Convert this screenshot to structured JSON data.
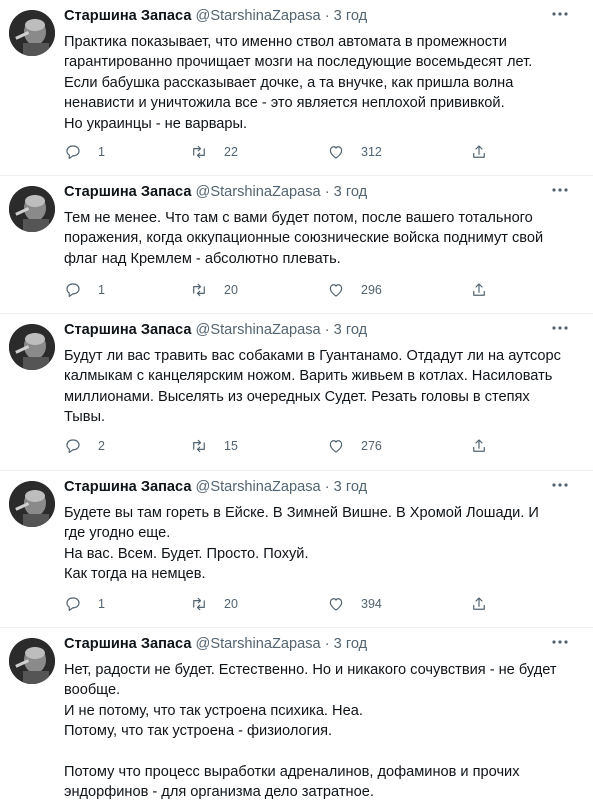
{
  "tweets": [
    {
      "name": "Старшина Запаса",
      "handle": "@StarshinaZapasa",
      "dot": "·",
      "time": "3 год",
      "text": "Практика показывает, что именно ствол автомата в промежности\nгарантированно прочищает мозги на последующие восемьдесят лет.\nЕсли бабушка рассказывает дочке, а та внучке, как пришла волна\nненависти и уничтожила все - это является неплохой прививкой.\nНо украинцы - не варвары.",
      "replies": "1",
      "retweets": "22",
      "likes": "312"
    },
    {
      "name": "Старшина Запаса",
      "handle": "@StarshinaZapasa",
      "dot": "·",
      "time": "3 год",
      "text": "Тем не менее. Что там с вами будет потом, после вашего тотального\nпоражения, когда оккупационные союзнические войска поднимут свой\nфлаг над Кремлем - абсолютно плевать.",
      "replies": "1",
      "retweets": "20",
      "likes": "296"
    },
    {
      "name": "Старшина Запаса",
      "handle": "@StarshinaZapasa",
      "dot": "·",
      "time": "3 год",
      "text": "Будут ли вас травить вас собаками в Гуантанамо. Отдадут ли на аутсорс\nкалмыкам с канцелярским ножом. Варить живьем в котлах. Насиловать\nмиллионами. Выселять из очередных Судет. Резать головы в степях\nТывы.",
      "replies": "2",
      "retweets": "15",
      "likes": "276"
    },
    {
      "name": "Старшина Запаса",
      "handle": "@StarshinaZapasa",
      "dot": "·",
      "time": "3 год",
      "text": "Будете вы там гореть в Ейске. В Зимней Вишне. В Хромой Лошади. И\nгде угодно еще.\nНа вас. Всем. Будет. Просто. Похуй.\nКак тогда на немцев.",
      "replies": "1",
      "retweets": "20",
      "likes": "394"
    },
    {
      "name": "Старшина Запаса",
      "handle": "@StarshinaZapasa",
      "dot": "·",
      "time": "3 год",
      "text": "Нет, радости не будет. Естественно. Но и никакого сочувствия - не будет\nвообще.\nИ не потому, что так устроена психика. Неа.\nПотому, что так устроена - физиология.\n\nПотому что процесс выработки адреналинов, дофаминов и прочих\nэндорфинов - для организма дело затратное.",
      "replies": "",
      "retweets": "",
      "likes": ""
    }
  ],
  "icons": {
    "reply": "reply-icon",
    "retweet": "retweet-icon",
    "like": "heart-icon",
    "share": "share-icon",
    "more": "more-icon"
  },
  "colors": {
    "text": "#0f1419",
    "secondary": "#536471",
    "divider": "#eff3f4"
  }
}
